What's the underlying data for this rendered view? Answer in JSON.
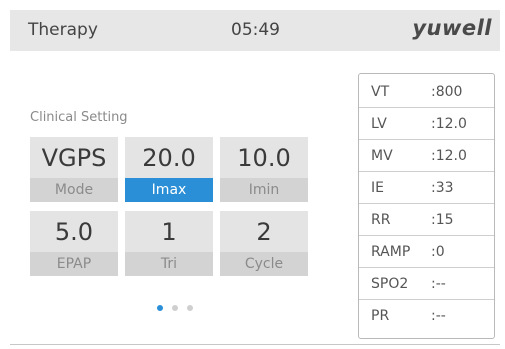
{
  "header": {
    "title": "Therapy",
    "time": "05:49",
    "brand": "yuwell"
  },
  "clinical": {
    "label": "Clinical Setting",
    "tiles": [
      {
        "value": "VGPS",
        "label": "Mode"
      },
      {
        "value": "20.0",
        "label": "Imax",
        "selected": true
      },
      {
        "value": "10.0",
        "label": "Imin"
      },
      {
        "value": "5.0",
        "label": "EPAP"
      },
      {
        "value": "1",
        "label": "Tri"
      },
      {
        "value": "2",
        "label": "Cycle"
      }
    ]
  },
  "pager": {
    "pages": 3,
    "current": 1
  },
  "stats": [
    {
      "key": "VT",
      "value": ":800"
    },
    {
      "key": "LV",
      "value": ":12.0"
    },
    {
      "key": "MV",
      "value": ":12.0"
    },
    {
      "key": "IE",
      "value": ":33"
    },
    {
      "key": "RR",
      "value": ":15"
    },
    {
      "key": "RAMP",
      "value": ":0"
    },
    {
      "key": "SPO2",
      "value": ":--"
    },
    {
      "key": "PR",
      "value": ":--"
    }
  ],
  "colors": {
    "accent": "#2a8fd6",
    "header_bg": "#e7e7e7"
  }
}
